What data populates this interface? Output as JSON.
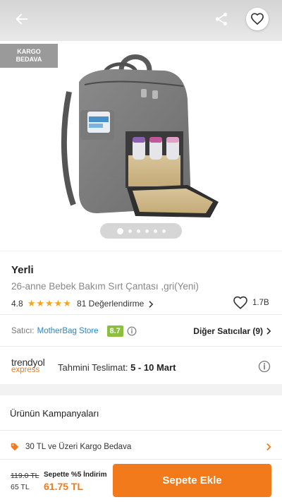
{
  "badge": {
    "kargo_line1": "KARGO",
    "kargo_line2": "BEDAVA"
  },
  "product": {
    "brand": "Yerli",
    "name": "26-anne Bebek Bakım Sırt Çantası ,gri(Yeni)",
    "rating": "4.8",
    "stars": "★★★★★",
    "rating_score": 4.8,
    "review_text": "81 Değerlendirme",
    "favorite_count": "1.7B",
    "image_pager": {
      "total": 6,
      "active": 1
    }
  },
  "seller": {
    "label": "Satıcı:",
    "name": "MotherBag Store",
    "score": "8.7",
    "other_sellers": "Diğer Satıcılar (9)"
  },
  "delivery": {
    "logo_top": "trendyol",
    "logo_bottom": "express",
    "label": "Tahmini Teslimat:",
    "value": "5 - 10 Mart"
  },
  "campaigns": {
    "title": "Ürünün Kampanyaları",
    "items": [
      {
        "text": "30 TL ve Üzeri Kargo Bedava"
      }
    ]
  },
  "bottom_bar": {
    "old_price": "119.0 TL",
    "price": "65 TL",
    "discount_label": "Sepette %5 İndirim",
    "final_price": "61.75 TL",
    "add_to_cart": "Sepete Ekle"
  },
  "colors": {
    "accent": "#f27a1a",
    "star": "#f8a31a",
    "seller_link": "#2c86c2",
    "seller_score": "#8cbf3e",
    "badge_bg": "#9a9a9a"
  },
  "icons": [
    "back-arrow-icon",
    "share-icon",
    "heart-icon",
    "star-icon",
    "chevron-right-icon",
    "info-icon",
    "tag-icon"
  ]
}
